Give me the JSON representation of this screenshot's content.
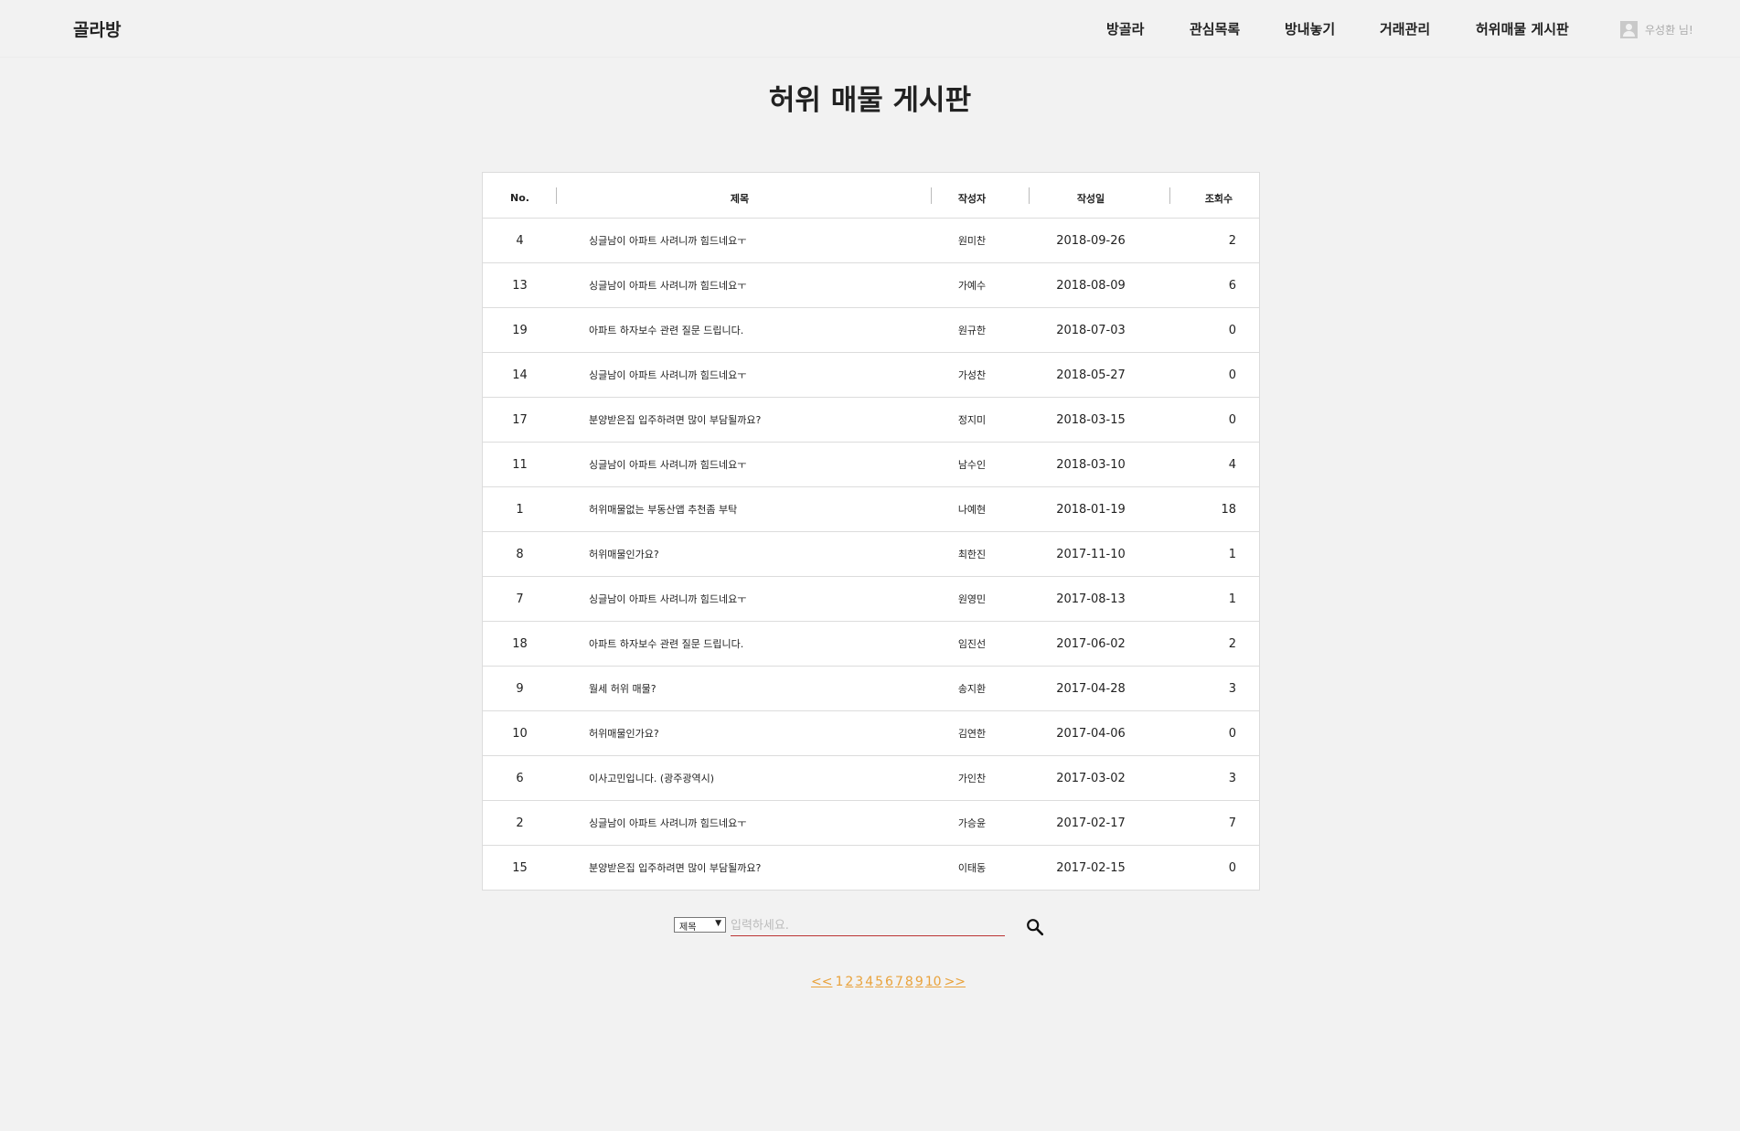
{
  "app": {
    "logo": "골라방"
  },
  "nav": {
    "items": [
      {
        "label": "방골라"
      },
      {
        "label": "관심목록"
      },
      {
        "label": "방내놓기"
      },
      {
        "label": "거래관리"
      },
      {
        "label": "허위매물 게시판"
      }
    ],
    "user": {
      "label": "우성환 님!",
      "icon": "user-icon"
    }
  },
  "page": {
    "title": "허위 매물 게시판"
  },
  "table": {
    "headers": {
      "no": "No.",
      "title": "제목",
      "author": "작성자",
      "date": "작성일",
      "views": "조회수"
    },
    "rows": [
      {
        "no": "4",
        "title": "싱글남이 아파트 사려니까 힘드네요ㅜ",
        "author": "원미찬",
        "date": "2018-09-26",
        "views": "2"
      },
      {
        "no": "13",
        "title": "싱글남이 아파트 사려니까 힘드네요ㅜ",
        "author": "가예수",
        "date": "2018-08-09",
        "views": "6"
      },
      {
        "no": "19",
        "title": "아파트 하자보수 관련 질문 드립니다.",
        "author": "원규한",
        "date": "2018-07-03",
        "views": "0"
      },
      {
        "no": "14",
        "title": "싱글남이 아파트 사려니까 힘드네요ㅜ",
        "author": "가성찬",
        "date": "2018-05-27",
        "views": "0"
      },
      {
        "no": "17",
        "title": "분양받은집 입주하려면 많이 부담될까요?",
        "author": "정지미",
        "date": "2018-03-15",
        "views": "0"
      },
      {
        "no": "11",
        "title": "싱글남이 아파트 사려니까 힘드네요ㅜ",
        "author": "남수인",
        "date": "2018-03-10",
        "views": "4"
      },
      {
        "no": "1",
        "title": "허위매물없는 부동산앱 추천좀 부탁",
        "author": "나예현",
        "date": "2018-01-19",
        "views": "18"
      },
      {
        "no": "8",
        "title": "허위매물인가요?",
        "author": "최한진",
        "date": "2017-11-10",
        "views": "1"
      },
      {
        "no": "7",
        "title": "싱글남이 아파트 사려니까 힘드네요ㅜ",
        "author": "원영민",
        "date": "2017-08-13",
        "views": "1"
      },
      {
        "no": "18",
        "title": "아파트 하자보수 관련 질문 드립니다.",
        "author": "임진선",
        "date": "2017-06-02",
        "views": "2"
      },
      {
        "no": "9",
        "title": "월세 허위 매물?",
        "author": "송지환",
        "date": "2017-04-28",
        "views": "3"
      },
      {
        "no": "10",
        "title": "허위매물인가요?",
        "author": "김연한",
        "date": "2017-04-06",
        "views": "0"
      },
      {
        "no": "6",
        "title": "이사고민입니다. (광주광역시)",
        "author": "가인찬",
        "date": "2017-03-02",
        "views": "3"
      },
      {
        "no": "2",
        "title": "싱글남이 아파트 사려니까 힘드네요ㅜ",
        "author": "가승윤",
        "date": "2017-02-17",
        "views": "7"
      },
      {
        "no": "15",
        "title": "분양받은집 입주하려면 많이 부담될까요?",
        "author": "이태동",
        "date": "2017-02-15",
        "views": "0"
      }
    ]
  },
  "search": {
    "select_value": "제목",
    "placeholder": "입력하세요.",
    "value": "",
    "button_icon": "search-icon"
  },
  "pagination": {
    "prev": "<<",
    "pages": [
      "1",
      "2",
      "3",
      "4",
      "5",
      "6",
      "7",
      "8",
      "9",
      "10"
    ],
    "next": ">>",
    "color": "#e9a23b"
  }
}
